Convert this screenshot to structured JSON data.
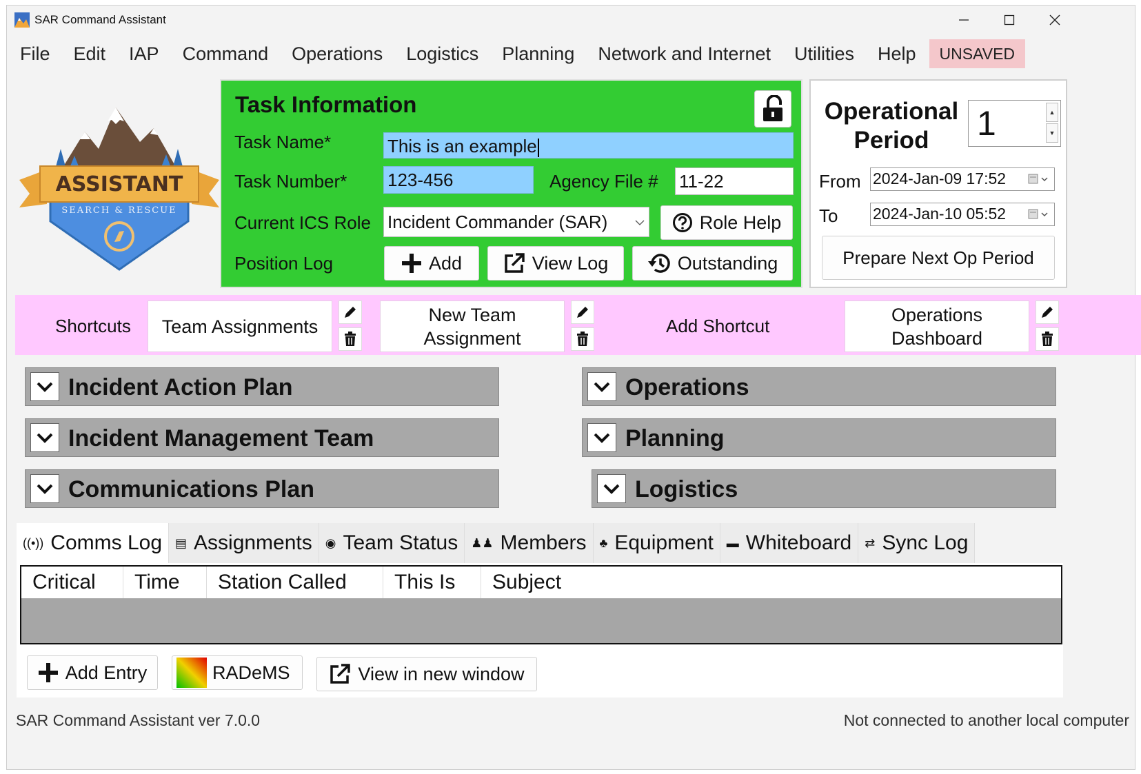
{
  "window": {
    "title": "SAR Command Assistant"
  },
  "menu": {
    "items": [
      "File",
      "Edit",
      "IAP",
      "Command",
      "Operations",
      "Logistics",
      "Planning",
      "Network and Internet",
      "Utilities",
      "Help"
    ],
    "status_badge": "UNSAVED"
  },
  "logo": {
    "main_text": "ASSISTANT",
    "sub_text": "SEARCH & RESCUE"
  },
  "task_info": {
    "title": "Task Information",
    "task_name_label": "Task Name*",
    "task_name_value": "This is an example",
    "task_number_label": "Task Number*",
    "task_number_value": "123-456",
    "agency_file_label": "Agency File #",
    "agency_file_value": "11-22",
    "ics_role_label": "Current ICS Role",
    "ics_role_value": "Incident Commander (SAR)",
    "role_help_label": "Role Help",
    "position_log_label": "Position Log",
    "add_label": "Add",
    "view_log_label": "View Log",
    "outstanding_label": "Outstanding",
    "panel_color": "#33cc33"
  },
  "op_period": {
    "title_line1": "Operational",
    "title_line2": "Period",
    "value": "1",
    "from_label": "From",
    "from_value": "2024-Jan-09 17:52",
    "to_label": "To",
    "to_value": "2024-Jan-10 05:52",
    "prepare_label": "Prepare Next Op Period"
  },
  "shortcuts": {
    "label": "Shortcuts",
    "items": [
      "Team Assignments",
      "New Team Assignment",
      "Operations Dashboard"
    ],
    "add_label": "Add Shortcut",
    "bar_color": "#ffc8ff"
  },
  "sections": [
    "Incident Action Plan",
    "Operations",
    "Incident Management Team",
    "Planning",
    "Communications Plan",
    "Logistics"
  ],
  "tabs": [
    {
      "label": "Comms Log",
      "icon": "radio-icon"
    },
    {
      "label": "Assignments",
      "icon": "clipboard-icon"
    },
    {
      "label": "Team Status",
      "icon": "status-icon"
    },
    {
      "label": "Members",
      "icon": "people-icon"
    },
    {
      "label": "Equipment",
      "icon": "equipment-icon"
    },
    {
      "label": "Whiteboard",
      "icon": "whiteboard-icon"
    },
    {
      "label": "Sync Log",
      "icon": "sync-icon"
    }
  ],
  "comms_log": {
    "columns": [
      "Critical",
      "Time",
      "Station Called",
      "This Is",
      "Subject"
    ],
    "add_entry_label": "Add Entry",
    "radems_label": "RADeMS",
    "view_window_label": "View in new window"
  },
  "status": {
    "version": "SAR Command Assistant ver 7.0.0",
    "connection": "Not connected to another local computer"
  }
}
